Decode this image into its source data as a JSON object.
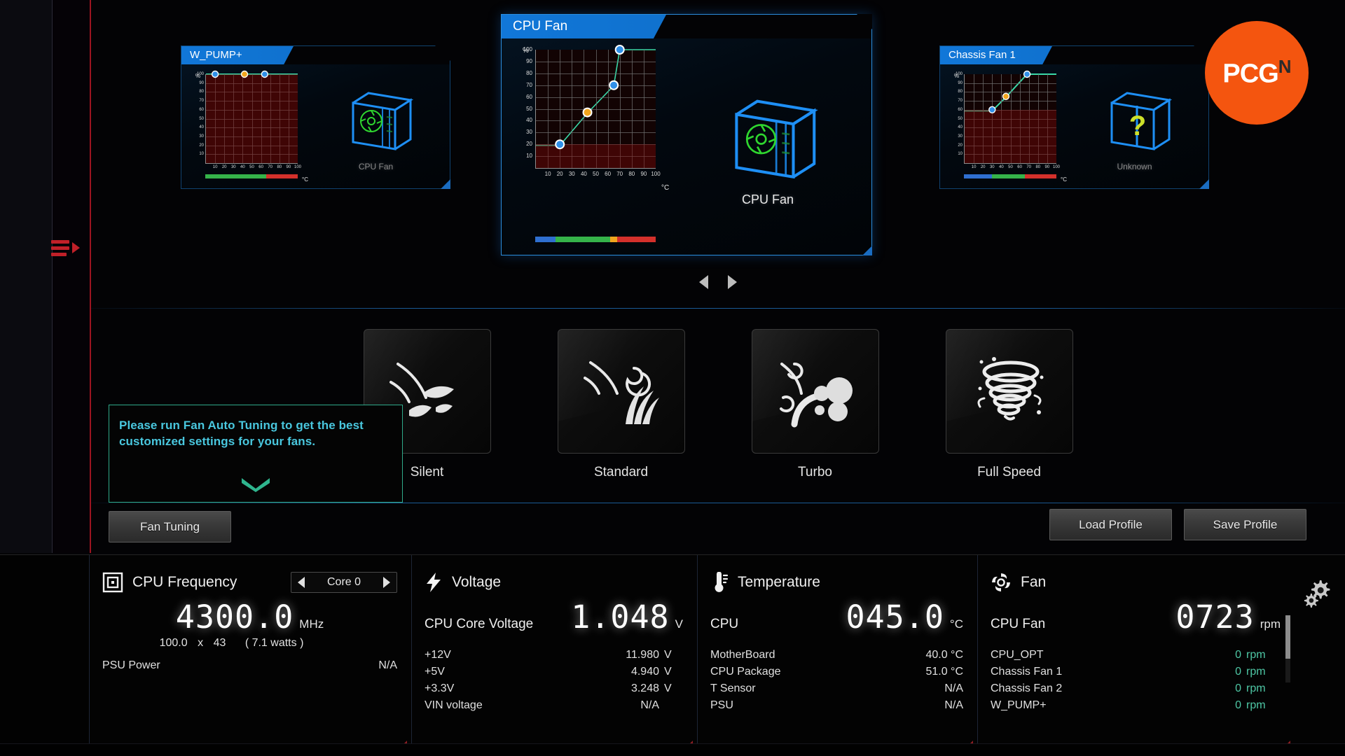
{
  "branding": {
    "logo_primary": "PCG",
    "logo_secondary": "N",
    "logo_color": "#f4550f"
  },
  "sidebar": {
    "toggle_icon": "hamburger-arrow-icon",
    "toggle_color": "#c02028"
  },
  "carousel": {
    "prev_icon": "chevron-left-icon",
    "next_icon": "chevron-right-icon",
    "cards": [
      {
        "title": "W_PUMP+",
        "device_label": "CPU Fan",
        "device_icon": "chassis-fan-icon",
        "selected": false,
        "axis_y_unit": "%",
        "axis_x_unit": "°C"
      },
      {
        "title": "CPU Fan",
        "device_label": "CPU Fan",
        "device_icon": "chassis-fan-icon",
        "selected": true,
        "axis_y_unit": "%",
        "axis_x_unit": "°C"
      },
      {
        "title": "Chassis Fan 1",
        "device_label": "Unknown",
        "device_icon": "chassis-unknown-icon",
        "selected": false,
        "axis_y_unit": "%",
        "axis_x_unit": "°C"
      }
    ]
  },
  "chart_data": [
    {
      "type": "line",
      "title": "W_PUMP+",
      "xlabel": "°C",
      "ylabel": "%",
      "xlim": [
        0,
        100
      ],
      "ylim": [
        0,
        100
      ],
      "xticks": [
        10,
        20,
        30,
        40,
        50,
        60,
        70,
        80,
        90,
        100
      ],
      "yticks": [
        10,
        20,
        30,
        40,
        50,
        60,
        70,
        80,
        90,
        100
      ],
      "grid": true,
      "points": [
        {
          "x": 10,
          "y": 100,
          "color": "#2f8fe8"
        },
        {
          "x": 42,
          "y": 100,
          "color": "#f0a51e"
        },
        {
          "x": 64,
          "y": 100,
          "color": "#2f8fe8"
        }
      ],
      "line": [
        [
          0,
          100
        ],
        [
          10,
          100
        ],
        [
          42,
          100
        ],
        [
          64,
          100
        ],
        [
          100,
          100
        ]
      ],
      "line_color": "#3ad9a8",
      "colorbar": [
        {
          "color": "#35b34a",
          "from": 0,
          "to": 66
        },
        {
          "color": "#d4302b",
          "from": 66,
          "to": 100
        }
      ]
    },
    {
      "type": "line",
      "title": "CPU Fan",
      "xlabel": "°C",
      "ylabel": "%",
      "xlim": [
        0,
        100
      ],
      "ylim": [
        0,
        100
      ],
      "xticks": [
        10,
        20,
        30,
        40,
        50,
        60,
        70,
        80,
        90,
        100
      ],
      "yticks": [
        10,
        20,
        30,
        40,
        50,
        60,
        70,
        80,
        90,
        100
      ],
      "grid": true,
      "points": [
        {
          "x": 20,
          "y": 20,
          "color": "#2f8fe8"
        },
        {
          "x": 43,
          "y": 47,
          "color": "#f0a51e"
        },
        {
          "x": 65,
          "y": 70,
          "color": "#2f8fe8"
        },
        {
          "x": 70,
          "y": 100,
          "color": "#2f8fe8"
        }
      ],
      "line": [
        [
          0,
          20
        ],
        [
          20,
          20
        ],
        [
          43,
          47
        ],
        [
          65,
          70
        ],
        [
          70,
          100
        ],
        [
          100,
          100
        ]
      ],
      "line_color": "#3ad9a8",
      "colorbar": [
        {
          "color": "#2f6fd0",
          "from": 0,
          "to": 17
        },
        {
          "color": "#35b34a",
          "from": 17,
          "to": 62
        },
        {
          "color": "#f0a51e",
          "from": 62,
          "to": 68
        },
        {
          "color": "#d4302b",
          "from": 68,
          "to": 100
        }
      ]
    },
    {
      "type": "line",
      "title": "Chassis Fan 1",
      "xlabel": "°C",
      "ylabel": "%",
      "xlim": [
        0,
        100
      ],
      "ylim": [
        0,
        100
      ],
      "xticks": [
        10,
        20,
        30,
        40,
        50,
        60,
        70,
        80,
        90,
        100
      ],
      "yticks": [
        10,
        20,
        30,
        40,
        50,
        60,
        70,
        80,
        90,
        100
      ],
      "grid": true,
      "points": [
        {
          "x": 30,
          "y": 60,
          "color": "#2f8fe8"
        },
        {
          "x": 45,
          "y": 75,
          "color": "#f0a51e"
        },
        {
          "x": 68,
          "y": 100,
          "color": "#2f8fe8"
        }
      ],
      "line": [
        [
          0,
          60
        ],
        [
          30,
          60
        ],
        [
          45,
          75
        ],
        [
          68,
          100
        ],
        [
          100,
          100
        ]
      ],
      "line_color": "#3ad9a8",
      "colorbar": [
        {
          "color": "#2f6fd0",
          "from": 0,
          "to": 30
        },
        {
          "color": "#35b34a",
          "from": 30,
          "to": 66
        },
        {
          "color": "#d4302b",
          "from": 66,
          "to": 100
        }
      ]
    }
  ],
  "presets": [
    {
      "label": "Silent",
      "icon": "leaf-breeze-icon"
    },
    {
      "label": "Standard",
      "icon": "wind-grass-icon"
    },
    {
      "label": "Turbo",
      "icon": "wind-branch-icon"
    },
    {
      "label": "Full Speed",
      "icon": "tornado-icon"
    }
  ],
  "tooltip": {
    "message": "Please run Fan Auto Tuning to get the best customized settings for your fans.",
    "chevron_icon": "chevron-down-icon",
    "border_color": "#2faa8a",
    "text_color": "#49c7de"
  },
  "buttons": {
    "fan_tuning": "Fan Tuning",
    "load_profile": "Load Profile",
    "save_profile": "Save Profile"
  },
  "monitor": {
    "cpu": {
      "icon": "cpu-chip-icon",
      "title": "CPU Frequency",
      "core_selector": {
        "value": "Core 0",
        "prev_icon": "chevron-left-icon",
        "next_icon": "chevron-right-icon"
      },
      "frequency": "4300.0",
      "frequency_unit": "MHz",
      "bclk": "100.0",
      "multiplier_sep": "x",
      "multiplier": "43",
      "watts": "( 7.1   watts )",
      "psu_power_label": "PSU Power",
      "psu_power_value": "N/A"
    },
    "voltage": {
      "icon": "lightning-bolt-icon",
      "title": "Voltage",
      "primary_label": "CPU Core Voltage",
      "primary_value": "1.048",
      "primary_unit": "V",
      "rows": [
        {
          "label": "+12V",
          "value": "11.980",
          "unit": "V"
        },
        {
          "label": "+5V",
          "value": "4.940",
          "unit": "V"
        },
        {
          "label": "+3.3V",
          "value": "3.248",
          "unit": "V"
        },
        {
          "label": "VIN voltage",
          "value": "N/A",
          "unit": ""
        }
      ]
    },
    "temperature": {
      "icon": "thermometer-icon",
      "title": "Temperature",
      "primary_label": "CPU",
      "primary_value": "045.0",
      "primary_unit": "°C",
      "rows": [
        {
          "label": "MotherBoard",
          "value": "40.0 °C",
          "unit": ""
        },
        {
          "label": "CPU Package",
          "value": "51.0 °C",
          "unit": ""
        },
        {
          "label": "T Sensor",
          "value": "N/A",
          "unit": ""
        },
        {
          "label": "PSU",
          "value": "N/A",
          "unit": ""
        }
      ]
    },
    "fan": {
      "icon": "fan-icon",
      "title": "Fan",
      "primary_label": "CPU Fan",
      "primary_value": "0723",
      "primary_unit": "rpm",
      "rows": [
        {
          "label": "CPU_OPT",
          "value": "0",
          "unit": "rpm"
        },
        {
          "label": "Chassis Fan 1",
          "value": "0",
          "unit": "rpm"
        },
        {
          "label": "Chassis Fan 2",
          "value": "0",
          "unit": "rpm"
        },
        {
          "label": "W_PUMP+",
          "value": "0",
          "unit": "rpm"
        }
      ],
      "value_color": "#4ec7a5"
    },
    "settings_icon": "gear-icon"
  }
}
